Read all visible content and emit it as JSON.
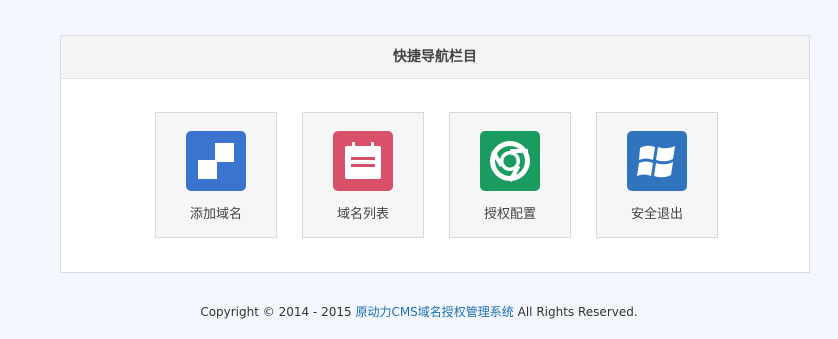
{
  "panel": {
    "title": "快捷导航栏目"
  },
  "tiles": [
    {
      "label": "添加域名",
      "icon": "windows-blocks-icon",
      "color": "#3a74cf"
    },
    {
      "label": "域名列表",
      "icon": "calendar-list-icon",
      "color": "#d9506a"
    },
    {
      "label": "授权配置",
      "icon": "chrome-icon",
      "color": "#1a9b5f"
    },
    {
      "label": "安全退出",
      "icon": "windows-logo-icon",
      "color": "#2f74bd"
    }
  ],
  "footer": {
    "prefix": "Copyright © 2014 - 2015",
    "link": "原动力CMS域名授权管理系统",
    "suffix": "All Rights Reserved."
  }
}
